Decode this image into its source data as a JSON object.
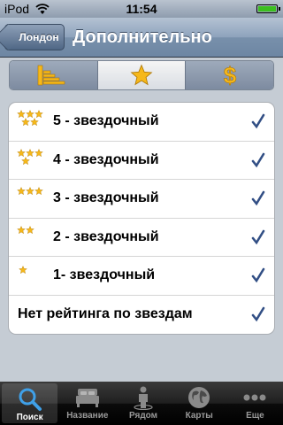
{
  "status_bar": {
    "carrier": "iPod",
    "time": "11:54"
  },
  "nav": {
    "back_label": "Лондон",
    "title": "Дополнительно"
  },
  "segments": [
    {
      "icon": "bar-chart-icon",
      "active": false
    },
    {
      "icon": "star-icon",
      "active": true
    },
    {
      "icon": "dollar-icon",
      "active": false
    }
  ],
  "ratings": [
    {
      "label": "5 - звездочный",
      "stars": 5,
      "checked": true
    },
    {
      "label": "4 - звездочный",
      "stars": 4,
      "checked": true
    },
    {
      "label": "3 - звездочный",
      "stars": 3,
      "checked": true
    },
    {
      "label": "2 - звездочный",
      "stars": 2,
      "checked": true
    },
    {
      "label": "1- звездочный",
      "stars": 1,
      "checked": true
    },
    {
      "label": "Нет рейтинга по звездам",
      "stars": 0,
      "checked": true
    }
  ],
  "tabs": [
    {
      "label": "Поиск",
      "icon": "search-icon",
      "active": true
    },
    {
      "label": "Название",
      "icon": "bed-icon",
      "active": false
    },
    {
      "label": "Рядом",
      "icon": "person-location-icon",
      "active": false
    },
    {
      "label": "Карты",
      "icon": "globe-icon",
      "active": false
    },
    {
      "label": "Еще",
      "icon": "more-icon",
      "active": false
    }
  ],
  "colors": {
    "accent_check": "#324f85",
    "star_gold": "#f6b81a",
    "nav_bar": "#6d86a3"
  }
}
